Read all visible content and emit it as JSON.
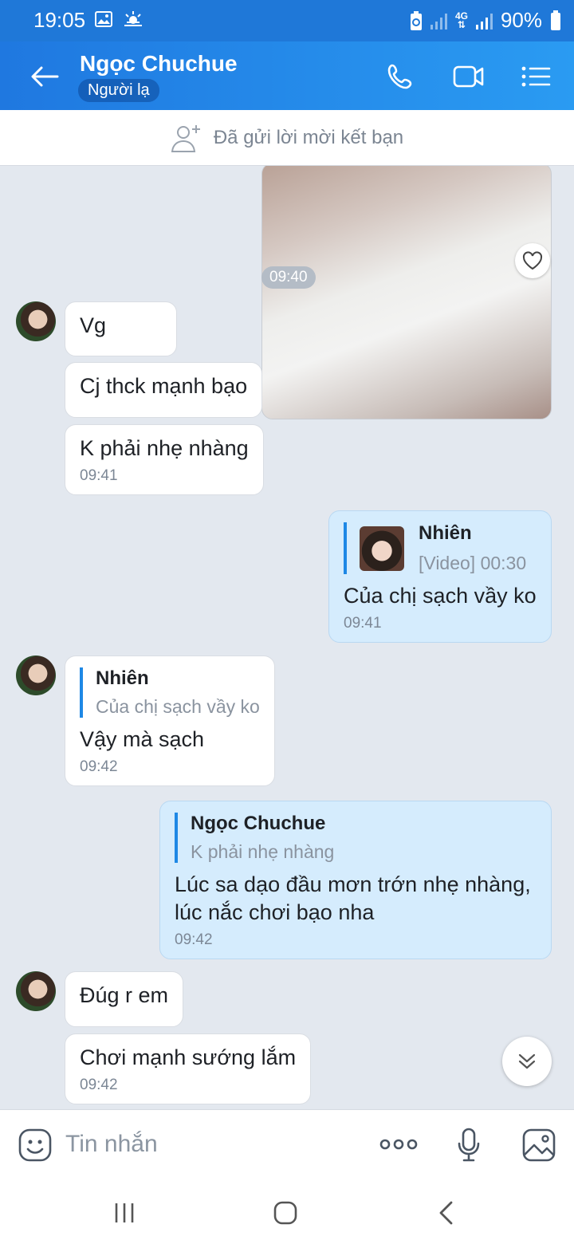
{
  "status_bar": {
    "time": "19:05",
    "network": "4G",
    "battery": "90%"
  },
  "header": {
    "title": "Ngọc Chuchue",
    "badge": "Người lạ"
  },
  "friend_request": {
    "text": "Đã gửi lời mời kết bạn"
  },
  "chat": {
    "media_time": "09:40",
    "messages": [
      {
        "text": "Vg"
      },
      {
        "text": "Cj thck mạnh bạo"
      },
      {
        "text": "K phải nhẹ nhàng",
        "time": "09:41"
      },
      {
        "quote_name": "Nhiên",
        "quote_text": "[Video] 00:30",
        "text": "Của chị sạch vầy ko",
        "time": "09:41"
      },
      {
        "quote_name": "Nhiên",
        "quote_text": "Của chị sạch vầy ko",
        "text": "Vậy mà sạch",
        "time": "09:42"
      },
      {
        "quote_name": "Ngọc Chuchue",
        "quote_text": "K phải nhẹ nhàng",
        "text_line1": "Lúc sa dạo đầu mơn trớn nhẹ nhàng,",
        "text_line2": "lúc nắc chơi bạo nha",
        "time": "09:42"
      },
      {
        "text": "Đúg r em"
      },
      {
        "text": "Chơi mạnh sướng lắm",
        "time": "09:42"
      }
    ]
  },
  "input": {
    "placeholder": "Tin nhắn"
  },
  "colors": {
    "accent": "#1f78e0",
    "my_bubble": "#d5ecfd",
    "background": "#e3e8ef"
  }
}
